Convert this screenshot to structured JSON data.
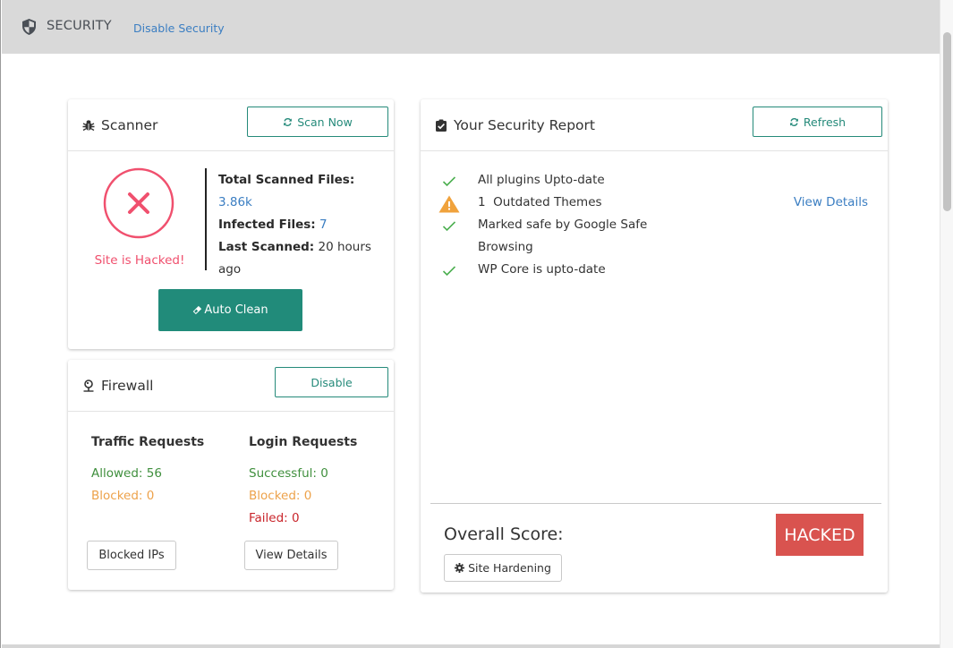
{
  "header": {
    "title": "SECURITY",
    "disable_link": "Disable Security",
    "icon": "shield-icon"
  },
  "scanner": {
    "title": "Scanner",
    "icon": "bug-icon",
    "scan_button": "Scan Now",
    "status_text": "Site is Hacked!",
    "status_icon": "x-circle-icon",
    "total_label": "Total Scanned Files:",
    "total_value": "3.86k",
    "infected_label": "Infected Files:",
    "infected_value": "7",
    "last_label": "Last Scanned:",
    "last_value": "20 hours ago",
    "auto_clean_button": "Auto Clean",
    "colors": {
      "danger": "#f0506e",
      "primary": "#218b7a",
      "link": "#3b7ec2"
    }
  },
  "firewall": {
    "title": "Firewall",
    "icon": "map-pin-icon",
    "disable_button": "Disable",
    "traffic": {
      "header": "Traffic Requests",
      "allowed": "Allowed: 56",
      "blocked": "Blocked: 0",
      "button": "Blocked IPs"
    },
    "login": {
      "header": "Login Requests",
      "successful": "Successful: 0",
      "blocked": "Blocked: 0",
      "failed": "Failed: 0",
      "button": "View Details"
    }
  },
  "report": {
    "title": "Your Security Report",
    "icon": "clipboard-check-icon",
    "refresh_button": "Refresh",
    "items": [
      {
        "status": "ok",
        "text": "All plugins Upto-date",
        "link": ""
      },
      {
        "status": "warning",
        "text": "1  Outdated Themes",
        "link": "View Details"
      },
      {
        "status": "ok",
        "text": "Marked safe by Google Safe Browsing",
        "link": ""
      },
      {
        "status": "ok",
        "text": "WP Core is upto-date",
        "link": ""
      }
    ],
    "score_label": "Overall Score:",
    "score_value": "HACKED",
    "hardening_button": "Site Hardening",
    "colors": {
      "ok": "#4caf50",
      "warning": "#f0a23c",
      "badge": "#d9534f"
    }
  }
}
